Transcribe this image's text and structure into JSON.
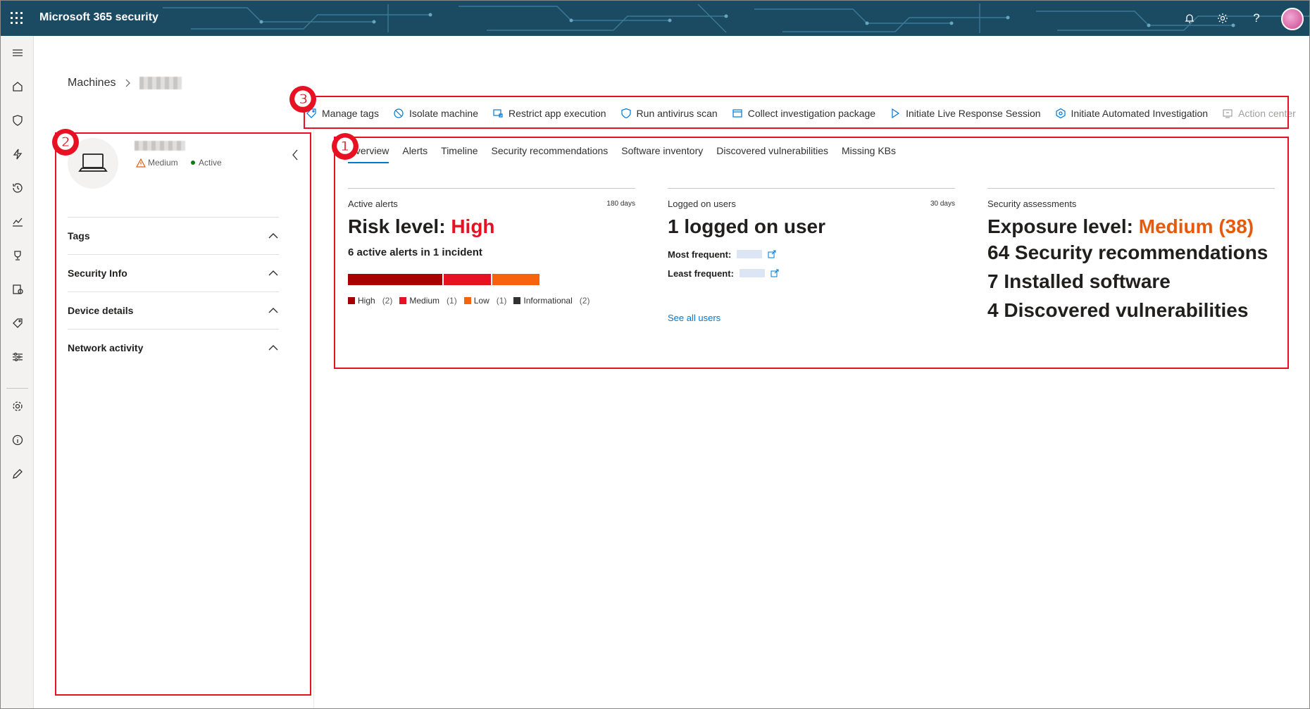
{
  "app": {
    "title": "Microsoft 365 security"
  },
  "breadcrumb": {
    "root": "Machines"
  },
  "machine": {
    "risk": "Medium",
    "status": "Active"
  },
  "side_sections": [
    "Tags",
    "Security Info",
    "Device details",
    "Network activity"
  ],
  "actions": [
    {
      "label": "Manage tags",
      "icon": "tag-icon",
      "enabled": true
    },
    {
      "label": "Isolate machine",
      "icon": "block-icon",
      "enabled": true
    },
    {
      "label": "Restrict app execution",
      "icon": "restrict-icon",
      "enabled": true
    },
    {
      "label": "Run antivirus scan",
      "icon": "shield-icon",
      "enabled": true
    },
    {
      "label": "Collect investigation package",
      "icon": "package-icon",
      "enabled": true
    },
    {
      "label": "Initiate Live Response Session",
      "icon": "play-icon",
      "enabled": true
    },
    {
      "label": "Initiate Automated Investigation",
      "icon": "investigation-icon",
      "enabled": true
    },
    {
      "label": "Action center",
      "icon": "action-center-icon",
      "enabled": false
    }
  ],
  "tabs": [
    "Overview",
    "Alerts",
    "Timeline",
    "Security recommendations",
    "Software inventory",
    "Discovered vulnerabilities",
    "Missing KBs"
  ],
  "active_tab": "Overview",
  "alerts_card": {
    "heading": "Active alerts",
    "days": "180 days",
    "risk_prefix": "Risk level: ",
    "risk_value": "High",
    "summary": "6 active alerts in 1 incident",
    "severity": [
      {
        "label": "High",
        "count": "(2)",
        "value": 2,
        "color": "#a80000"
      },
      {
        "label": "Medium",
        "count": "(1)",
        "value": 1,
        "color": "#e81123"
      },
      {
        "label": "Low",
        "count": "(1)",
        "value": 1,
        "color": "#f7630c"
      },
      {
        "label": "Informational",
        "count": "(2)",
        "value": 2,
        "color": "#323130"
      }
    ]
  },
  "users_card": {
    "heading": "Logged on users",
    "days": "30 days",
    "headline": "1 logged on user",
    "most_frequent": "Most frequent:",
    "least_frequent": "Least frequent:",
    "link": "See all users"
  },
  "assessments_card": {
    "heading": "Security assessments",
    "exposure_prefix": "Exposure level: ",
    "exposure_value": "Medium (38)",
    "recommendations": "64 Security recommendations",
    "software": "7 Installed software",
    "vulnerabilities": "4 Discovered vulnerabilities"
  },
  "annotations": [
    "❶",
    "❷",
    "❸"
  ],
  "colors": {
    "accent": "#0078d4",
    "danger": "#e81123",
    "warning": "#e65a0c",
    "topbar": "#1b4a63"
  }
}
